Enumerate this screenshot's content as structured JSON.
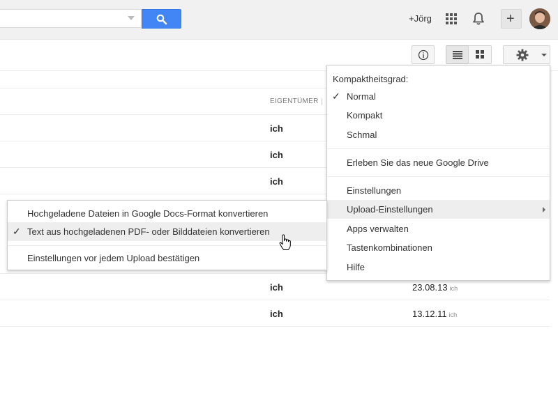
{
  "header": {
    "search": {
      "placeholder": ""
    },
    "user_link": "+Jörg",
    "icons": {
      "apps": "apps-grid-icon",
      "notifications": "bell-icon",
      "share": "plus-icon",
      "search": "magnifier-icon"
    },
    "colors": {
      "search_button": "#4285f4",
      "bar_background": "#f1f1f1"
    }
  },
  "toolbar": {
    "icons": {
      "info": "info-icon",
      "list_view": "list-view-icon",
      "grid_view": "grid-view-icon",
      "settings": "gear-icon"
    }
  },
  "table": {
    "owner_header": "EIGENTÜMER",
    "rows": [
      {
        "owner": "ich"
      },
      {
        "owner": "ich"
      },
      {
        "owner": "ich"
      },
      {
        "owner": "ich",
        "date": "23.08.13",
        "date_owner": "ich"
      },
      {
        "owner": "ich",
        "date": "13.12.11",
        "date_owner": "ich"
      }
    ]
  },
  "settings_menu": {
    "density_header": "Kompaktheitsgrad:",
    "density_options": [
      {
        "label": "Normal",
        "checked": true
      },
      {
        "label": "Kompakt",
        "checked": false
      },
      {
        "label": "Schmal",
        "checked": false
      }
    ],
    "new_drive": "Erleben Sie das neue Google Drive",
    "items": [
      {
        "label": "Einstellungen"
      },
      {
        "label": "Upload-Einstellungen",
        "submenu": true,
        "active": true
      },
      {
        "label": "Apps verwalten"
      },
      {
        "label": "Tastenkombinationen"
      },
      {
        "label": "Hilfe"
      }
    ],
    "check_glyph": "✓"
  },
  "upload_submenu": {
    "items": [
      {
        "label": "Hochgeladene Dateien in Google Docs-Format konvertieren",
        "checked": false
      },
      {
        "label": "Text aus hochgeladenen PDF- oder Bilddateien konvertieren",
        "checked": true
      },
      {
        "label": "Einstellungen vor jedem Upload bestätigen",
        "checked": false
      }
    ]
  }
}
